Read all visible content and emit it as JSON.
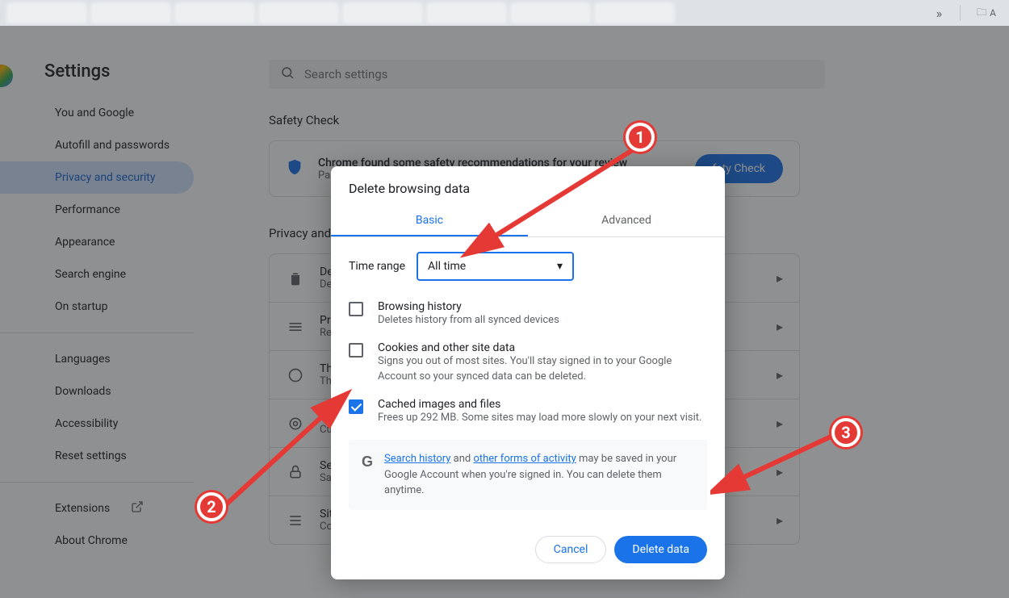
{
  "tabStrip": {
    "tabs": [
      "",
      "",
      "",
      "",
      "",
      "",
      "",
      ""
    ],
    "overflowGlyph": "»",
    "folderLabel": "A"
  },
  "header": {
    "title": "Settings",
    "searchPlaceholder": "Search settings"
  },
  "nav": {
    "items": [
      {
        "label": "You and Google"
      },
      {
        "label": "Autofill and passwords"
      },
      {
        "label": "Privacy and security",
        "active": true
      },
      {
        "label": "Performance"
      },
      {
        "label": "Appearance"
      },
      {
        "label": "Search engine"
      },
      {
        "label": "On startup"
      }
    ],
    "secondary": [
      {
        "label": "Languages"
      },
      {
        "label": "Downloads"
      },
      {
        "label": "Accessibility"
      },
      {
        "label": "Reset settings"
      }
    ],
    "footer": [
      {
        "label": "Extensions",
        "external": true
      },
      {
        "label": "About Chrome"
      }
    ]
  },
  "safetyCheck": {
    "section": "Safety Check",
    "title": "Chrome found some safety recommendations for your review",
    "subtitle": "Pas",
    "button": "fety Check"
  },
  "privacySection": {
    "label": "Privacy and",
    "rows": [
      {
        "title": "De",
        "sub": "De"
      },
      {
        "title": "Pri",
        "sub": "Re"
      },
      {
        "title": "Th",
        "sub": "Th"
      },
      {
        "title": "A",
        "sub": "Cu"
      },
      {
        "title": "Se",
        "sub": "Sa"
      },
      {
        "title": "Sit",
        "sub": "Co"
      }
    ]
  },
  "dialog": {
    "title": "Delete browsing data",
    "tabs": {
      "basic": "Basic",
      "advanced": "Advanced"
    },
    "timeRange": {
      "label": "Time range",
      "value": "All time"
    },
    "options": [
      {
        "title": "Browsing history",
        "sub": "Deletes history from all synced devices",
        "checked": false
      },
      {
        "title": "Cookies and other site data",
        "sub": "Signs you out of most sites. You'll stay signed in to your Google Account so your synced data can be deleted.",
        "checked": false
      },
      {
        "title": "Cached images and files",
        "sub": "Frees up 292 MB. Some sites may load more slowly on your next visit.",
        "checked": true
      }
    ],
    "info": {
      "link1": "Search history",
      "mid": " and ",
      "link2": "other forms of activity",
      "tail": " may be saved in your Google Account when you're signed in. You can delete them anytime."
    },
    "actions": {
      "cancel": "Cancel",
      "delete": "Delete data"
    }
  },
  "annotations": {
    "m1": "1",
    "m2": "2",
    "m3": "3"
  }
}
